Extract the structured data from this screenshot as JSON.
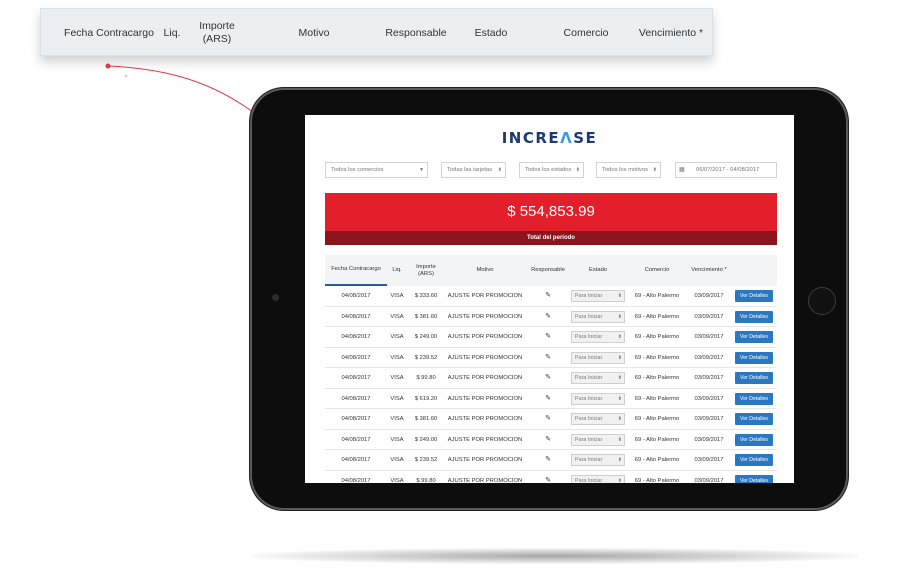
{
  "zoom_header": {
    "columns": [
      "Fecha Contracargo",
      "Liq.",
      "Importe\n(ARS)",
      "Motivo",
      "Responsable",
      "Estado",
      "Comercio",
      "Vencimiento *"
    ]
  },
  "app": {
    "logo_left": "INCRE",
    "logo_accent": "Λ",
    "logo_right": "SE",
    "accent_color": "#e31f2b",
    "brand_color": "#1d3a6e",
    "button_color": "#2b78c2"
  },
  "filters": {
    "comercios": "Todos los comercios",
    "tarjetas": "Todas las tarjetas",
    "estados": "Todos los estados",
    "motivos": "Todos los motivos",
    "date_range": "06/07/2017 - 04/08/2017"
  },
  "total": {
    "amount": "$ 554,853.99",
    "label": "Total del período"
  },
  "table": {
    "headers": [
      "Fecha Contracargo",
      "Liq.",
      "Importe\n(ARS)",
      "Motivo",
      "Responsable",
      "Estado",
      "Comercio",
      "Vencimiento *"
    ],
    "rows": [
      {
        "fecha": "04/08/2017",
        "liq": "VISA",
        "importe": "$ 333.60",
        "motivo": "AJUSTE POR PROMOCION",
        "estado": "Para Iniciar",
        "comercio": "69 - Alto Palermo",
        "vencimiento": "03/09/2017",
        "accion": "Ver Detalles"
      },
      {
        "fecha": "04/08/2017",
        "liq": "VISA",
        "importe": "$ 381.60",
        "motivo": "AJUSTE POR PROMOCION",
        "estado": "Para Iniciar",
        "comercio": "69 - Alto Palermo",
        "vencimiento": "03/09/2017",
        "accion": "Ver Detalles"
      },
      {
        "fecha": "04/08/2017",
        "liq": "VISA",
        "importe": "$ 249.00",
        "motivo": "AJUSTE POR PROMOCION",
        "estado": "Para Iniciar",
        "comercio": "69 - Alto Palermo",
        "vencimiento": "03/09/2017",
        "accion": "Ver Detalles"
      },
      {
        "fecha": "04/08/2017",
        "liq": "VISA",
        "importe": "$ 239.52",
        "motivo": "AJUSTE POR PROMOCION",
        "estado": "Para Iniciar",
        "comercio": "69 - Alto Palermo",
        "vencimiento": "03/09/2017",
        "accion": "Ver Detalles"
      },
      {
        "fecha": "04/08/2017",
        "liq": "VISA",
        "importe": "$ 99.80",
        "motivo": "AJUSTE POR PROMOCION",
        "estado": "Para Iniciar",
        "comercio": "69 - Alto Palermo",
        "vencimiento": "03/09/2017",
        "accion": "Ver Detalles"
      },
      {
        "fecha": "04/08/2017",
        "liq": "VISA",
        "importe": "$ 619.20",
        "motivo": "AJUSTE POR PROMOCION",
        "estado": "Para Iniciar",
        "comercio": "69 - Alto Palermo",
        "vencimiento": "03/09/2017",
        "accion": "Ver Detalles"
      },
      {
        "fecha": "04/08/2017",
        "liq": "VISA",
        "importe": "$ 381.60",
        "motivo": "AJUSTE POR PROMOCION",
        "estado": "Para Iniciar",
        "comercio": "69 - Alto Palermo",
        "vencimiento": "03/09/2017",
        "accion": "Ver Detalles"
      },
      {
        "fecha": "04/08/2017",
        "liq": "VISA",
        "importe": "$ 249.00",
        "motivo": "AJUSTE POR PROMOCION",
        "estado": "Para Iniciar",
        "comercio": "69 - Alto Palermo",
        "vencimiento": "03/09/2017",
        "accion": "Ver Detalles"
      },
      {
        "fecha": "04/08/2017",
        "liq": "VISA",
        "importe": "$ 239.52",
        "motivo": "AJUSTE POR PROMOCION",
        "estado": "Para Iniciar",
        "comercio": "69 - Alto Palermo",
        "vencimiento": "03/09/2017",
        "accion": "Ver Detalles"
      },
      {
        "fecha": "04/08/2017",
        "liq": "VISA",
        "importe": "$ 99.80",
        "motivo": "AJUSTE POR PROMOCION",
        "estado": "Para Iniciar",
        "comercio": "69 - Alto Palermo",
        "vencimiento": "03/09/2017",
        "accion": "Ver Detalles"
      }
    ]
  }
}
